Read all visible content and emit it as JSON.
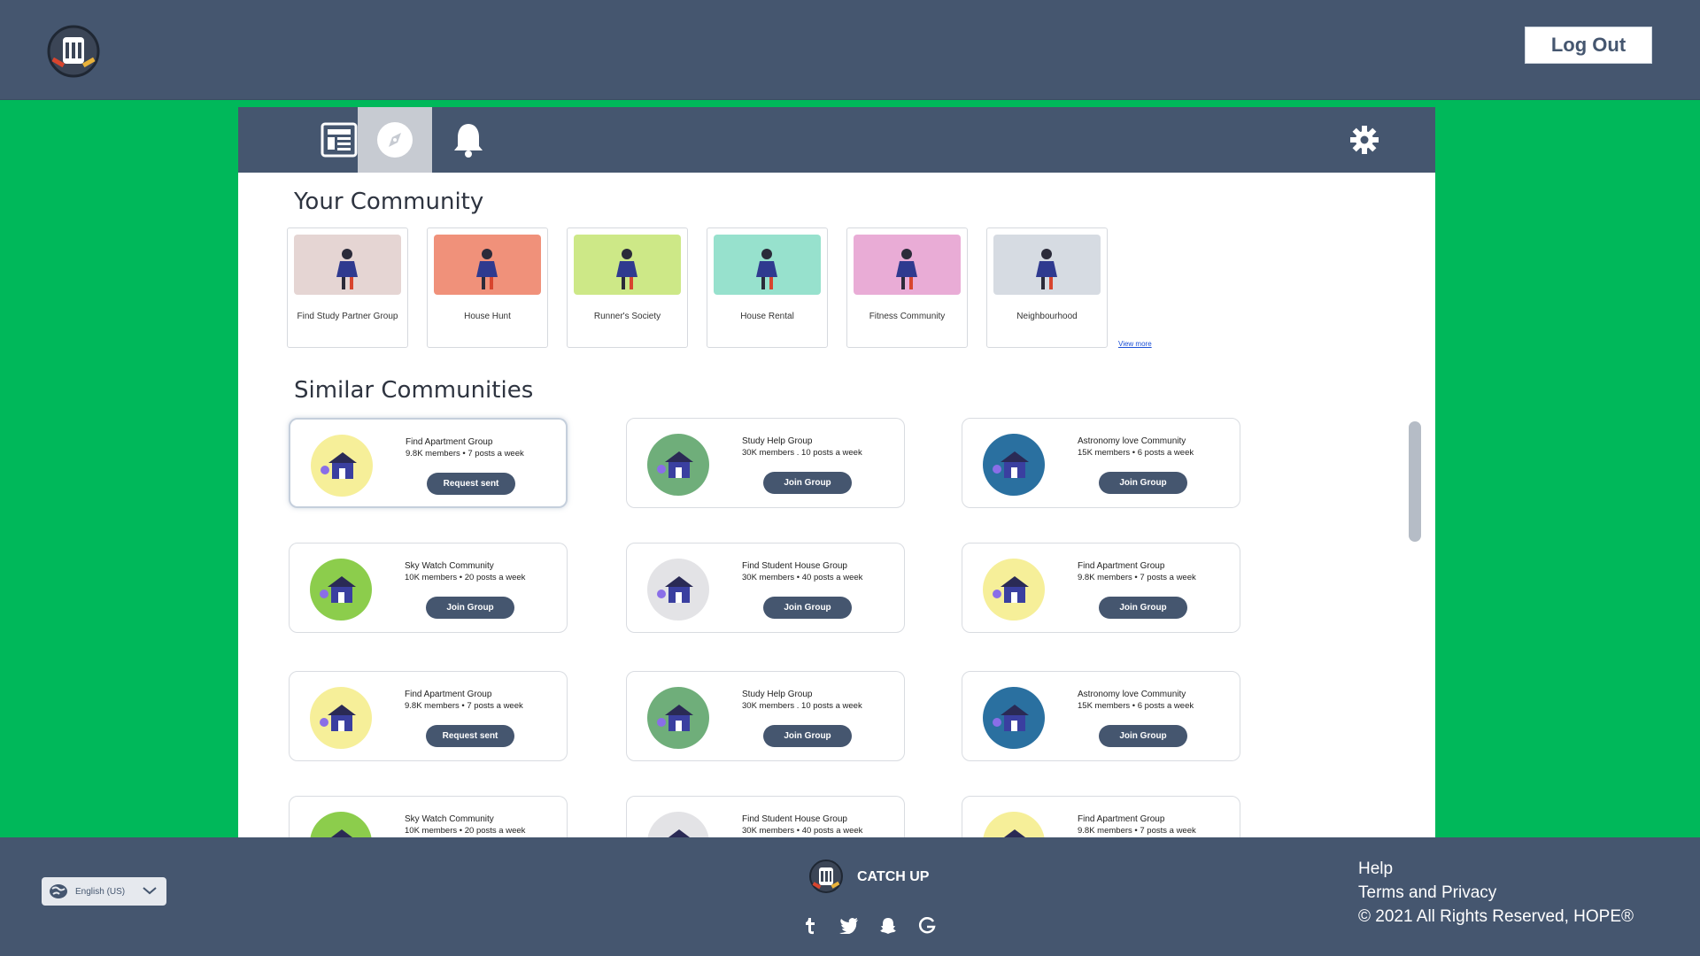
{
  "header": {
    "logout_label": "Log Out"
  },
  "tabs": [
    {
      "name": "feed-icon",
      "active": false
    },
    {
      "name": "compass-icon",
      "active": true
    },
    {
      "name": "bell-icon",
      "active": false
    }
  ],
  "your_community": {
    "title": "Your Community",
    "view_more": "View more",
    "items": [
      {
        "label": "Find Study Partner Group",
        "color": "#e5d5d3"
      },
      {
        "label": "House Hunt",
        "color": "#f0917a"
      },
      {
        "label": "Runner's Society",
        "color": "#cde887"
      },
      {
        "label": "House Rental",
        "color": "#97e1cd"
      },
      {
        "label": "Fitness Community",
        "color": "#e9acd6"
      },
      {
        "label": "Neighbourhood",
        "color": "#d6dbe2"
      }
    ]
  },
  "similar": {
    "title": "Similar Communities",
    "cards": [
      {
        "name": "Find Apartment Group",
        "meta": "9.8K members • 7 posts a week",
        "button": "Request sent",
        "color": "#f6ef99"
      },
      {
        "name": "Study Help Group",
        "meta": "30K members . 10 posts a week",
        "button": "Join Group",
        "color": "#6fae7a"
      },
      {
        "name": "Astronomy love Community",
        "meta": "15K members • 6 posts a week",
        "button": "Join Group",
        "color": "#2a70a0"
      },
      {
        "name": "Sky Watch Community",
        "meta": "10K members • 20 posts a week",
        "button": "Join Group",
        "color": "#8ccd4c"
      },
      {
        "name": "Find Student House Group",
        "meta": "30K members • 40 posts a week",
        "button": "Join Group",
        "color": "#e3e3e6"
      },
      {
        "name": "Find Apartment Group",
        "meta": "9.8K members • 7 posts a week",
        "button": "Join Group",
        "color": "#f6ef99"
      },
      {
        "name": "Find Apartment Group",
        "meta": "9.8K members • 7 posts a week",
        "button": "Request sent",
        "color": "#f6ef99"
      },
      {
        "name": "Study Help Group",
        "meta": "30K members . 10 posts a week",
        "button": "Join Group",
        "color": "#6fae7a"
      },
      {
        "name": "Astronomy love Community",
        "meta": "15K members • 6 posts a week",
        "button": "Join Group",
        "color": "#2a70a0"
      },
      {
        "name": "Sky Watch Community",
        "meta": "10K members • 20 posts a week",
        "color": "#8ccd4c"
      },
      {
        "name": "Find Student House Group",
        "meta": "30K members • 40 posts a week",
        "color": "#e3e3e6"
      },
      {
        "name": "Find Apartment Group",
        "meta": "9.8K members • 7 posts a week",
        "color": "#f6ef99"
      }
    ]
  },
  "footer": {
    "language": "English (US)",
    "brand": "CATCH UP",
    "links": {
      "help": "Help",
      "terms": "Terms and Privacy",
      "copyright": "© 2021 All Rights Reserved, HOPE®"
    },
    "socials": [
      "tumblr-icon",
      "twitter-icon",
      "snapchat-icon",
      "google-icon"
    ]
  },
  "colors": {
    "background": "#00b85a",
    "bar": "#45566f",
    "active_tab": "#c7cbd2"
  }
}
